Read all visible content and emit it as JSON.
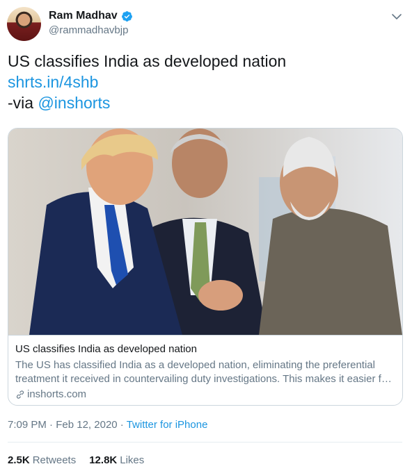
{
  "author": {
    "name": "Ram Madhav",
    "handle": "@rammadhavbjp",
    "verified": true
  },
  "tweet": {
    "line1": "US classifies India as developed nation",
    "link": "shrts.in/4shb",
    "via_prefix": "-via ",
    "via_mention": "@inshorts"
  },
  "card": {
    "title": "US classifies India as developed nation",
    "description": "The US has classified India as a developed nation, eliminating the preferential treatment it received in countervailing duty investigations. This makes it easier for India to face such investigations.",
    "domain": "inshorts.com"
  },
  "meta": {
    "time": "7:09 PM",
    "separator1": " · ",
    "date": "Feb 12, 2020",
    "separator2": " · ",
    "source": "Twitter for iPhone"
  },
  "stats": {
    "retweets_count": "2.5K",
    "retweets_label": "Retweets",
    "likes_count": "12.8K",
    "likes_label": "Likes"
  },
  "colors": {
    "link_blue": "#1b95e0",
    "secondary_text": "#657786",
    "primary_text": "#14171a",
    "border": "#ccd6dd"
  }
}
